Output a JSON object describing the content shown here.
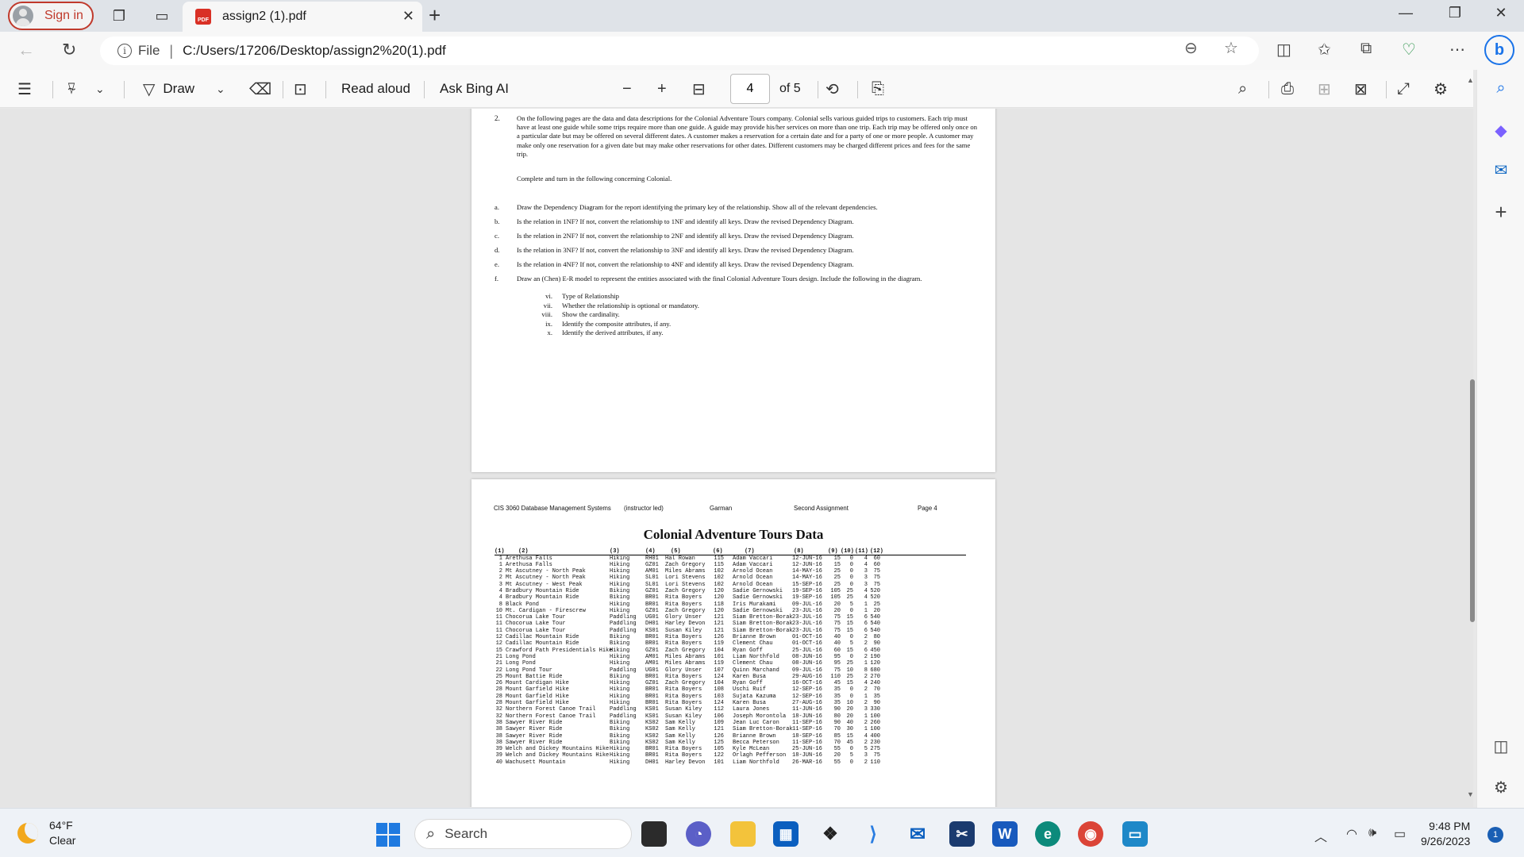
{
  "browser": {
    "signin_label": "Sign in",
    "tab_title": "assign2 (1).pdf",
    "tab_badge": "PDF",
    "file_label": "File",
    "url": "C:/Users/17206/Desktop/assign2%20(1).pdf"
  },
  "pdf_toolbar": {
    "draw_label": "Draw",
    "read_aloud_label": "Read aloud",
    "ask_ai_label": "Ask Bing AI",
    "current_page": "4",
    "page_total": "of 5"
  },
  "page3": {
    "item_number": "2.",
    "intro": "On the following pages are the data and data descriptions for the Colonial Adventure Tours company.  Colonial sells various guided trips to customers.  Each trip must have at least one guide while some trips require more than one guide.  A guide may provide his/her services on more than one trip.  Each trip may be offered only once on a particular date but may be offered on several different dates.  A customer makes a reservation for a certain date and for a party of one or more people.  A customer may make only one reservation for a given date but may make other reservations for other dates.  Different customers may be charged different prices and fees for the same trip.",
    "instruction": "Complete and turn in the following concerning Colonial.",
    "questions": [
      {
        "letter": "a.",
        "text": "Draw the Dependency Diagram for the report identifying the primary key of the relationship.  Show all of the relevant dependencies."
      },
      {
        "letter": "b.",
        "text": "Is the relation in 1NF?  If not, convert the relationship to 1NF and identify all keys.  Draw the revised Dependency Diagram."
      },
      {
        "letter": "c.",
        "text": "Is the relation in 2NF?  If not, convert the relationship to 2NF and identify all keys.  Draw the revised Dependency Diagram."
      },
      {
        "letter": "d.",
        "text": "Is the relation in 3NF?  If not, convert the relationship to 3NF and identify all keys.  Draw the revised Dependency Diagram."
      },
      {
        "letter": "e.",
        "text": "Is the relation in 4NF?  If not, convert the relationship to 4NF and identify all keys.  Draw the revised Dependency Diagram."
      },
      {
        "letter": "f.",
        "text": "Draw an (Chen) E-R model to represent the entities associated with the final Colonial Adventure Tours design.  Include the following in the diagram."
      }
    ],
    "sub_items": [
      {
        "num": "vi.",
        "text": "Type of Relationship"
      },
      {
        "num": "vii.",
        "text": "Whether the relationship is optional or mandatory."
      },
      {
        "num": "viii.",
        "text": "Show the cardinality."
      },
      {
        "num": "ix.",
        "text": "Identify the composite attributes, if any."
      },
      {
        "num": "x.",
        "text": "Identify the derived attributes, if any."
      }
    ]
  },
  "page4": {
    "header": {
      "course": "CIS 3060 Database Management Systems",
      "mode": "(instructor led)",
      "instructor": "Garman",
      "assignment": "Second Assignment",
      "page": "Page 4"
    },
    "title": "Colonial Adventure Tours Data",
    "columns": [
      "(1)",
      "(2)",
      "(3)",
      "(4)",
      "(5)",
      "(6)",
      "(7)",
      "(8)",
      "(9)",
      "(10)",
      "(11)",
      "(12)"
    ],
    "rows": [
      [
        "1",
        "Arethusa Falls",
        "Hiking",
        "RH01",
        "Hal Rowan",
        "115",
        "Adam Vaccari",
        "12-JUN-16",
        "15",
        "0",
        "4",
        "60"
      ],
      [
        "1",
        "Arethusa Falls",
        "Hiking",
        "GZ01",
        "Zach Gregory",
        "115",
        "Adam Vaccari",
        "12-JUN-16",
        "15",
        "0",
        "4",
        "60"
      ],
      [
        "2",
        "Mt Ascutney - North Peak",
        "Hiking",
        "AM01",
        "Miles Abrams",
        "102",
        "Arnold Ocean",
        "14-MAY-16",
        "25",
        "0",
        "3",
        "75"
      ],
      [
        "2",
        "Mt Ascutney - North Peak",
        "Hiking",
        "SL01",
        "Lori Stevens",
        "102",
        "Arnold Ocean",
        "14-MAY-16",
        "25",
        "0",
        "3",
        "75"
      ],
      [
        "3",
        "Mt Ascutney - West Peak",
        "Hiking",
        "SL01",
        "Lori Stevens",
        "102",
        "Arnold Ocean",
        "15-SEP-16",
        "25",
        "0",
        "3",
        "75"
      ],
      [
        "4",
        "Bradbury Mountain Ride",
        "Biking",
        "GZ01",
        "Zach Gregory",
        "120",
        "Sadie Gernowski",
        "19-SEP-16",
        "105",
        "25",
        "4",
        "520"
      ],
      [
        "4",
        "Bradbury Mountain Ride",
        "Biking",
        "BR01",
        "Rita Boyers",
        "120",
        "Sadie Gernowski",
        "19-SEP-16",
        "105",
        "25",
        "4",
        "520"
      ],
      [
        "8",
        "Black Pond",
        "Hiking",
        "BR01",
        "Rita Boyers",
        "118",
        "Iris Murakami",
        "09-JUL-16",
        "20",
        "5",
        "1",
        "25"
      ],
      [
        "10",
        "Mt. Cardigan - Firescrew",
        "Hiking",
        "GZ01",
        "Zach Gregory",
        "120",
        "Sadie Gernowski",
        "23-JUL-16",
        "20",
        "0",
        "1",
        "20"
      ],
      [
        "11",
        "Chocorua Lake Tour",
        "Paddling",
        "UG01",
        "Glory Unser",
        "121",
        "Siam Bretton-Borak",
        "23-JUL-16",
        "75",
        "15",
        "6",
        "540"
      ],
      [
        "11",
        "Chocorua Lake Tour",
        "Paddling",
        "DH01",
        "Harley Devon",
        "121",
        "Siam Bretton-Borak",
        "23-JUL-16",
        "75",
        "15",
        "6",
        "540"
      ],
      [
        "11",
        "Chocorua Lake Tour",
        "Paddling",
        "KS01",
        "Susan Kiley",
        "121",
        "Siam Bretton-Borak",
        "23-JUL-16",
        "75",
        "15",
        "6",
        "540"
      ],
      [
        "12",
        "Cadillac Mountain Ride",
        "Biking",
        "BR01",
        "Rita Boyers",
        "126",
        "Brianne Brown",
        "01-OCT-16",
        "40",
        "0",
        "2",
        "80"
      ],
      [
        "12",
        "Cadillac Mountain Ride",
        "Biking",
        "BR01",
        "Rita Boyers",
        "119",
        "Clement Chau",
        "01-OCT-16",
        "40",
        "5",
        "2",
        "90"
      ],
      [
        "15",
        "Crawford Path Presidentials Hike",
        "Hiking",
        "GZ01",
        "Zach Gregory",
        "104",
        "Ryan Goff",
        "25-JUL-16",
        "60",
        "15",
        "6",
        "450"
      ],
      [
        "21",
        "Long Pond",
        "Hiking",
        "AM01",
        "Miles Abrams",
        "101",
        "Liam Northfold",
        "08-JUN-16",
        "95",
        "0",
        "2",
        "190"
      ],
      [
        "21",
        "Long Pond",
        "Hiking",
        "AM01",
        "Miles Abrams",
        "119",
        "Clement Chau",
        "08-JUN-16",
        "95",
        "25",
        "1",
        "120"
      ],
      [
        "22",
        "Long Pond Tour",
        "Paddling",
        "UG01",
        "Glory Unser",
        "107",
        "Quinn Marchand",
        "09-JUL-16",
        "75",
        "10",
        "8",
        "680"
      ],
      [
        "25",
        "Mount Battie Ride",
        "Biking",
        "BR01",
        "Rita Boyers",
        "124",
        "Karen Busa",
        "29-AUG-16",
        "110",
        "25",
        "2",
        "270"
      ],
      [
        "26",
        "Mount Cardigan Hike",
        "Hiking",
        "GZ01",
        "Zach Gregory",
        "104",
        "Ryan Goff",
        "16-OCT-16",
        "45",
        "15",
        "4",
        "240"
      ],
      [
        "28",
        "Mount Garfield Hike",
        "Hiking",
        "BR01",
        "Rita Boyers",
        "108",
        "Uschi Ruif",
        "12-SEP-16",
        "35",
        "0",
        "2",
        "70"
      ],
      [
        "28",
        "Mount Garfield Hike",
        "Hiking",
        "BR01",
        "Rita Boyers",
        "103",
        "Sujata Kazuma",
        "12-SEP-16",
        "35",
        "0",
        "1",
        "35"
      ],
      [
        "28",
        "Mount Garfield Hike",
        "Hiking",
        "BR01",
        "Rita Boyers",
        "124",
        "Karen Busa",
        "27-AUG-16",
        "35",
        "10",
        "2",
        "90"
      ],
      [
        "32",
        "Northern Forest Canoe Trail",
        "Paddling",
        "KS01",
        "Susan Kiley",
        "112",
        "Laura Jones",
        "11-JUN-16",
        "90",
        "20",
        "3",
        "330"
      ],
      [
        "32",
        "Northern Forest Canoe Trail",
        "Paddling",
        "KS01",
        "Susan Kiley",
        "106",
        "Joseph Morontola",
        "18-JUN-16",
        "80",
        "20",
        "1",
        "100"
      ],
      [
        "38",
        "Sawyer River Ride",
        "Biking",
        "KS02",
        "Sam Kelly",
        "109",
        "Jean Luc Caron",
        "11-SEP-16",
        "90",
        "40",
        "2",
        "260"
      ],
      [
        "38",
        "Sawyer River Ride",
        "Biking",
        "KS02",
        "Sam Kelly",
        "121",
        "Siam Bretton-Borak",
        "11-SEP-16",
        "70",
        "30",
        "1",
        "100"
      ],
      [
        "38",
        "Sawyer River Ride",
        "Biking",
        "KS02",
        "Sam Kelly",
        "126",
        "Brianne Brown",
        "18-SEP-16",
        "85",
        "15",
        "4",
        "400"
      ],
      [
        "38",
        "Sawyer River Ride",
        "Biking",
        "KS02",
        "Sam Kelly",
        "125",
        "Becca Peterson",
        "11-SEP-16",
        "70",
        "45",
        "2",
        "230"
      ],
      [
        "39",
        "Welch and Dickey Mountains Hike",
        "Hiking",
        "BR01",
        "Rita Boyers",
        "105",
        "Kyle McLean",
        "25-JUN-16",
        "55",
        "0",
        "5",
        "275"
      ],
      [
        "39",
        "Welch and Dickey Mountains Hike",
        "Hiking",
        "BR01",
        "Rita Boyers",
        "122",
        "Orlagh Pefferson",
        "18-JUN-16",
        "20",
        "5",
        "3",
        "75"
      ],
      [
        "40",
        "Wachusett Mountain",
        "Hiking",
        "DH01",
        "Harley Devon",
        "101",
        "Liam Northfold",
        "26-MAR-16",
        "55",
        "0",
        "2",
        "110"
      ]
    ]
  },
  "taskbar": {
    "temperature": "64°F",
    "condition": "Clear",
    "search_label": "Search",
    "time": "9:48 PM",
    "date": "9/26/2023",
    "notification_count": "1"
  }
}
